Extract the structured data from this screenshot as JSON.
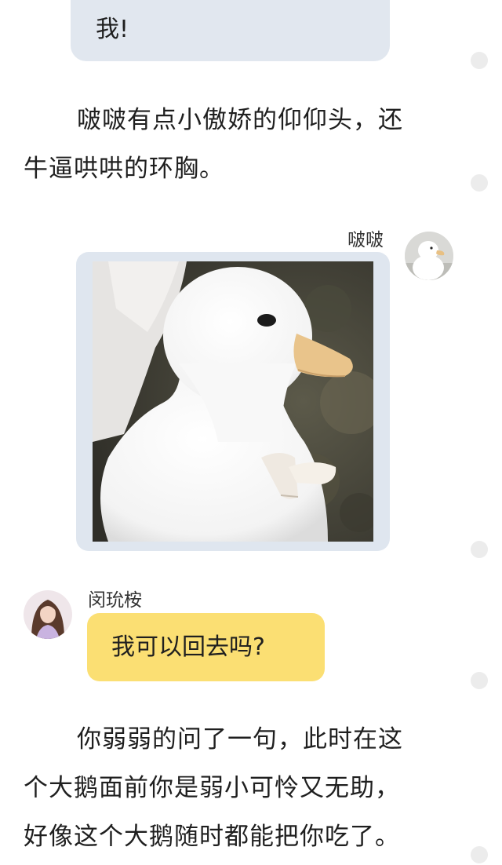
{
  "chat": {
    "top_bubble_text": "我!",
    "narration_1": [
      "啵啵有点小傲娇的仰仰头，还",
      "牛逼哄哄的环胸。"
    ],
    "sender_1_name": "啵啵",
    "reply_name": "闵玧桉",
    "reply_text": "我可以回去吗?",
    "narration_2": [
      "你弱弱的问了一句，此时在这",
      "个大鹅面前你是弱小可怜又无助，",
      "好像这个大鹅随时都能把你吃了。"
    ]
  },
  "colors": {
    "bubble_gray": "#e1e7ef",
    "bubble_yellow": "#fbdf73",
    "gutter_dot": "#ececec"
  },
  "icons": {
    "duck_image": "duck-sticker-image",
    "duck_avatar": "duck-avatar",
    "girl_avatar": "girl-avatar"
  }
}
